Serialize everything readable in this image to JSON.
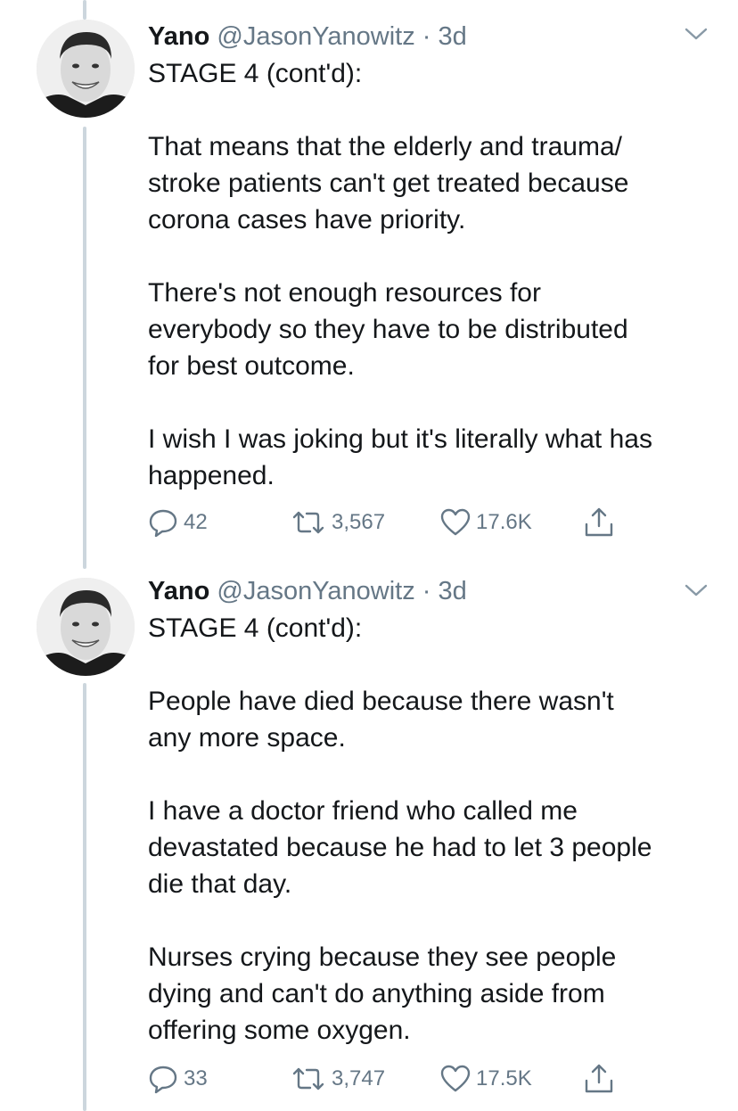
{
  "tweets": [
    {
      "name": "Yano",
      "handle": "@JasonYanowitz",
      "separator": "·",
      "time": "3d",
      "paragraphs": [
        "STAGE 4 (cont'd):",
        "That means that the elderly and trauma/",
        "stroke patients can't get treated because",
        "corona cases have priority.",
        "There's not enough resources for",
        "everybody so they have to be distributed",
        "for best outcome.",
        "I wish I was joking but it's literally what has",
        "happened."
      ],
      "replies": "42",
      "retweets": "3,567",
      "likes": "17.6K"
    },
    {
      "name": "Yano",
      "handle": "@JasonYanowitz",
      "separator": "·",
      "time": "3d",
      "paragraphs": [
        "STAGE 4 (cont'd):",
        "People have died because there wasn't",
        "any more space.",
        "I have a doctor friend who called me",
        "devastated because he had to let 3 people",
        "die that day.",
        "Nurses crying because they see people",
        "dying and can't do anything aside from",
        "offering some oxygen."
      ],
      "replies": "33",
      "retweets": "3,747",
      "likes": "17.5K"
    }
  ],
  "icons": {
    "reply": "reply-icon",
    "retweet": "retweet-icon",
    "like": "heart-icon",
    "share": "share-icon",
    "menu": "chevron-down-icon"
  },
  "colors": {
    "text": "#14171a",
    "secondary": "#657786",
    "thread_line": "#ccd6dd"
  }
}
